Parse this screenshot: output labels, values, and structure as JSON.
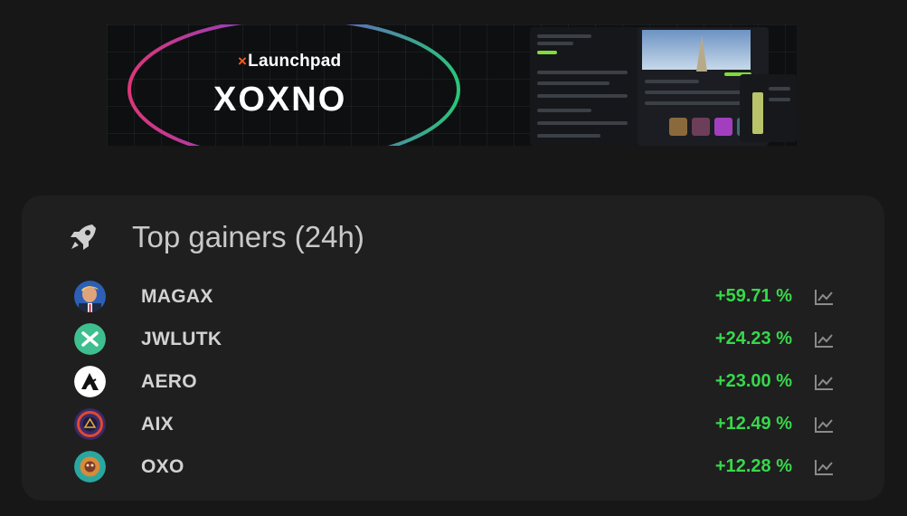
{
  "banner": {
    "tagline_prefix": "×",
    "tagline": "Launchpad",
    "brand": "XOXNO"
  },
  "top_gainers": {
    "title": "Top gainers (24h)",
    "icon": "rocket-icon",
    "items": [
      {
        "symbol": "MAGAX",
        "change": "+59.71 %",
        "avatar": "magax-token-avatar"
      },
      {
        "symbol": "JWLUTK",
        "change": "+24.23 %",
        "avatar": "jwlutk-token-avatar"
      },
      {
        "symbol": "AERO",
        "change": "+23.00 %",
        "avatar": "aero-token-avatar"
      },
      {
        "symbol": "AIX",
        "change": "+12.49 %",
        "avatar": "aix-token-avatar"
      },
      {
        "symbol": "OXO",
        "change": "+12.28 %",
        "avatar": "oxo-token-avatar"
      }
    ]
  },
  "colors": {
    "page_bg": "#171717",
    "card_bg": "#1f1f1f",
    "positive": "#37d84b",
    "text": "#d2d2d2",
    "title": "#c9c9c9",
    "accent": "#ff5a1f"
  }
}
